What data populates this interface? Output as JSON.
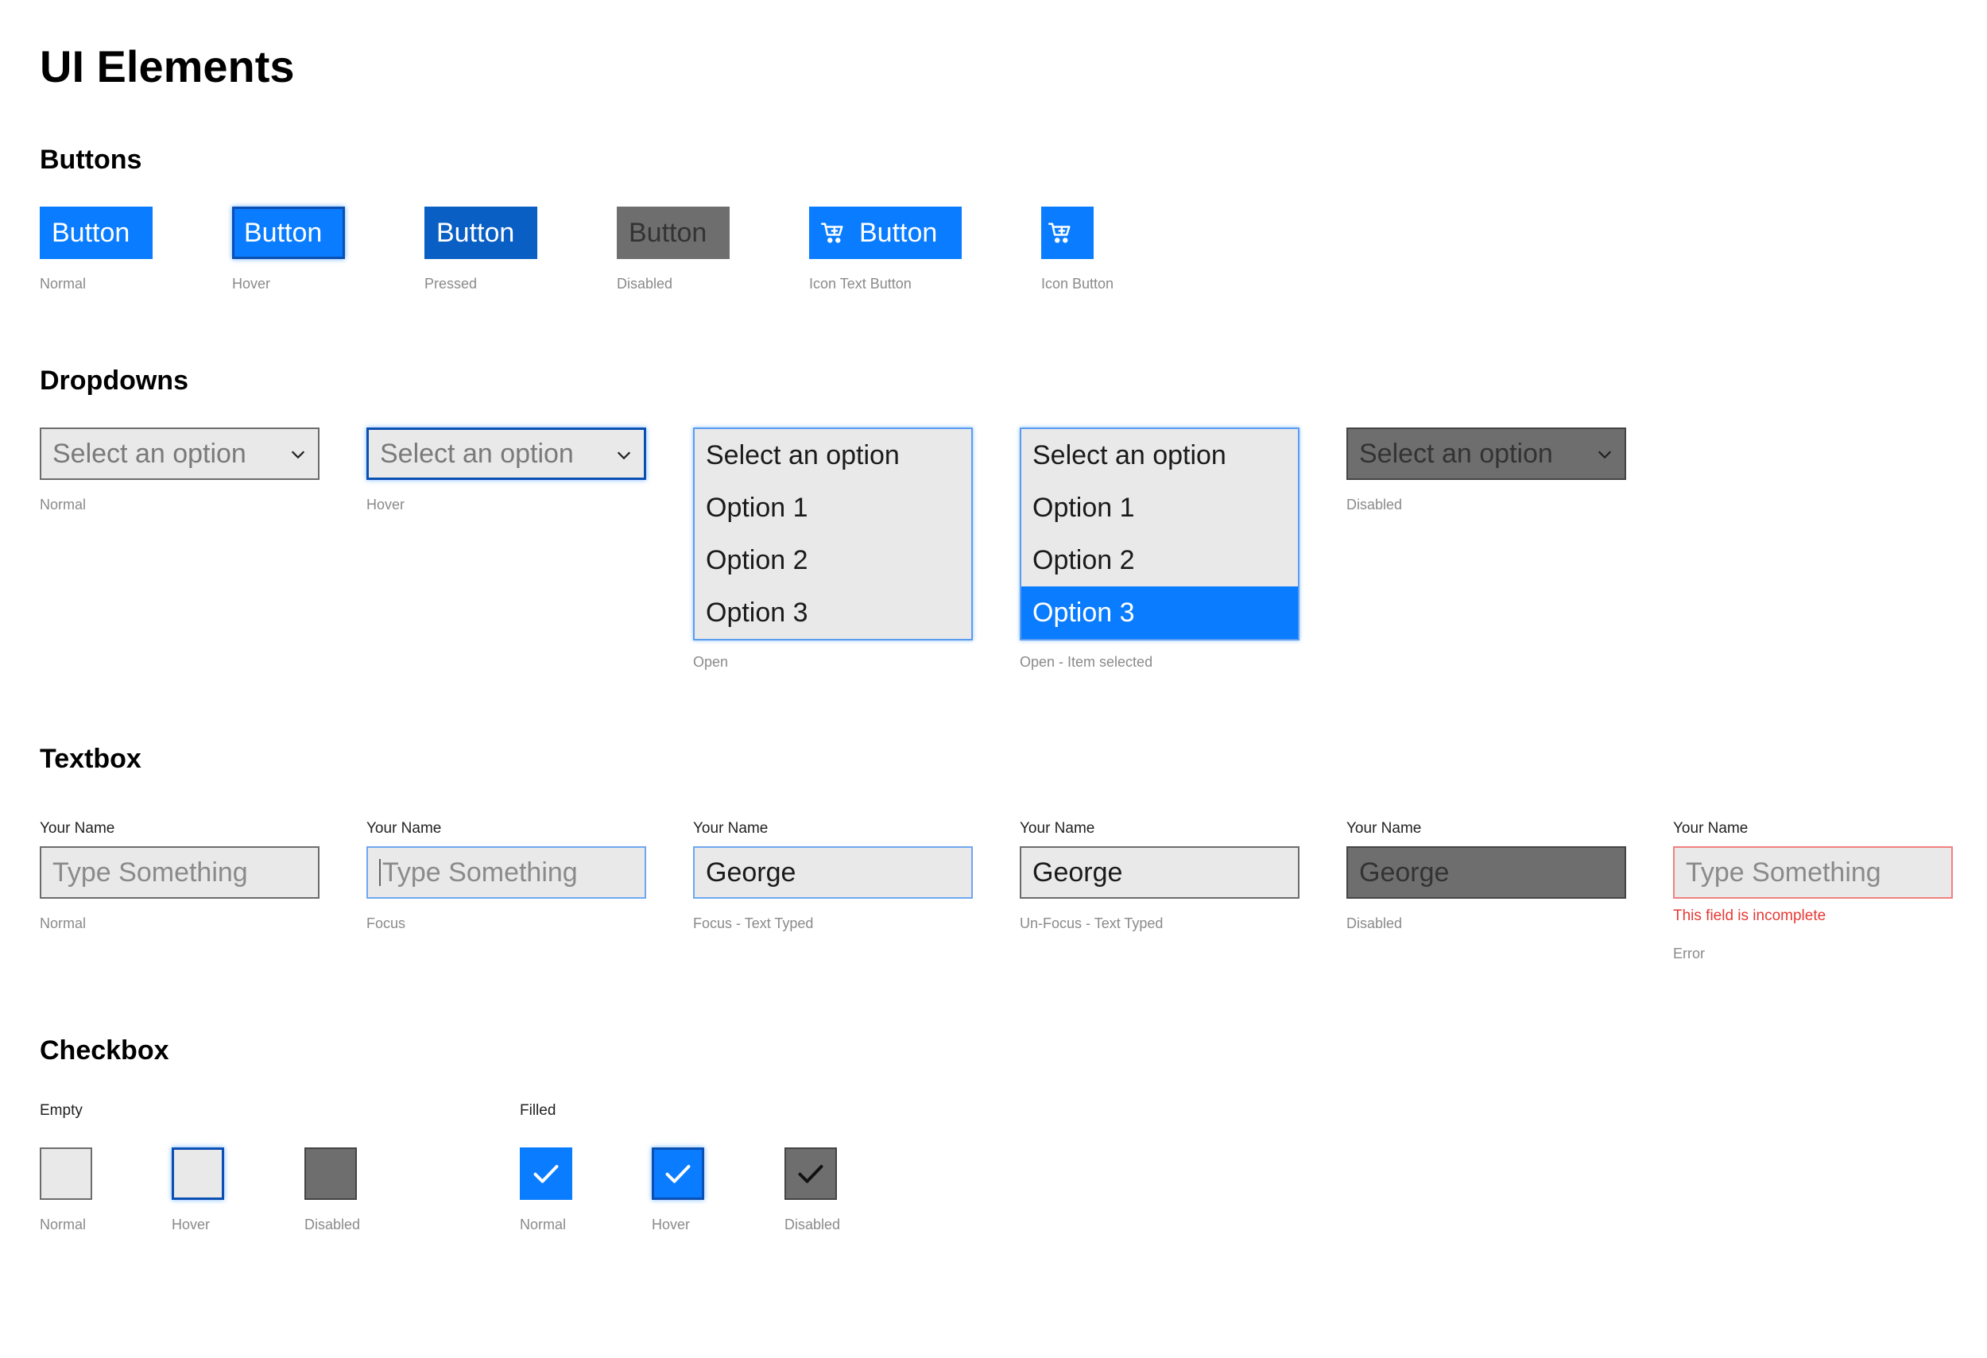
{
  "page_title": "UI Elements",
  "buttons": {
    "title": "Buttons",
    "items": [
      {
        "label": "Button",
        "caption": "Normal"
      },
      {
        "label": "Button",
        "caption": "Hover"
      },
      {
        "label": "Button",
        "caption": "Pressed"
      },
      {
        "label": "Button",
        "caption": "Disabled"
      },
      {
        "label": "Button",
        "caption": "Icon Text Button",
        "icon": "cart-add-icon"
      },
      {
        "label": "",
        "caption": "Icon Button",
        "icon": "cart-add-icon"
      }
    ]
  },
  "dropdowns": {
    "title": "Dropdowns",
    "placeholder": "Select an option",
    "options": [
      "Option 1",
      "Option 2",
      "Option 3"
    ],
    "selected": "Option 3",
    "captions": [
      "Normal",
      "Hover",
      "Open",
      "Open - Item selected",
      "Disabled"
    ]
  },
  "textbox": {
    "title": "Textbox",
    "label": "Your Name",
    "placeholder": "Type Something",
    "typed_value": "George",
    "error_message": "This field is incomplete",
    "captions": [
      "Normal",
      "Focus",
      "Focus - Text Typed",
      "Un-Focus - Text Typed",
      "Disabled",
      "Error"
    ]
  },
  "checkbox": {
    "title": "Checkbox",
    "empty_label": "Empty",
    "filled_label": "Filled",
    "captions": [
      "Normal",
      "Hover",
      "Disabled"
    ]
  },
  "colors": {
    "accent": "#0a7cff",
    "accent_dark": "#0b4fb3",
    "disabled": "#6e6e6e",
    "field_bg": "#e9e9e9",
    "error": "#e53935"
  }
}
